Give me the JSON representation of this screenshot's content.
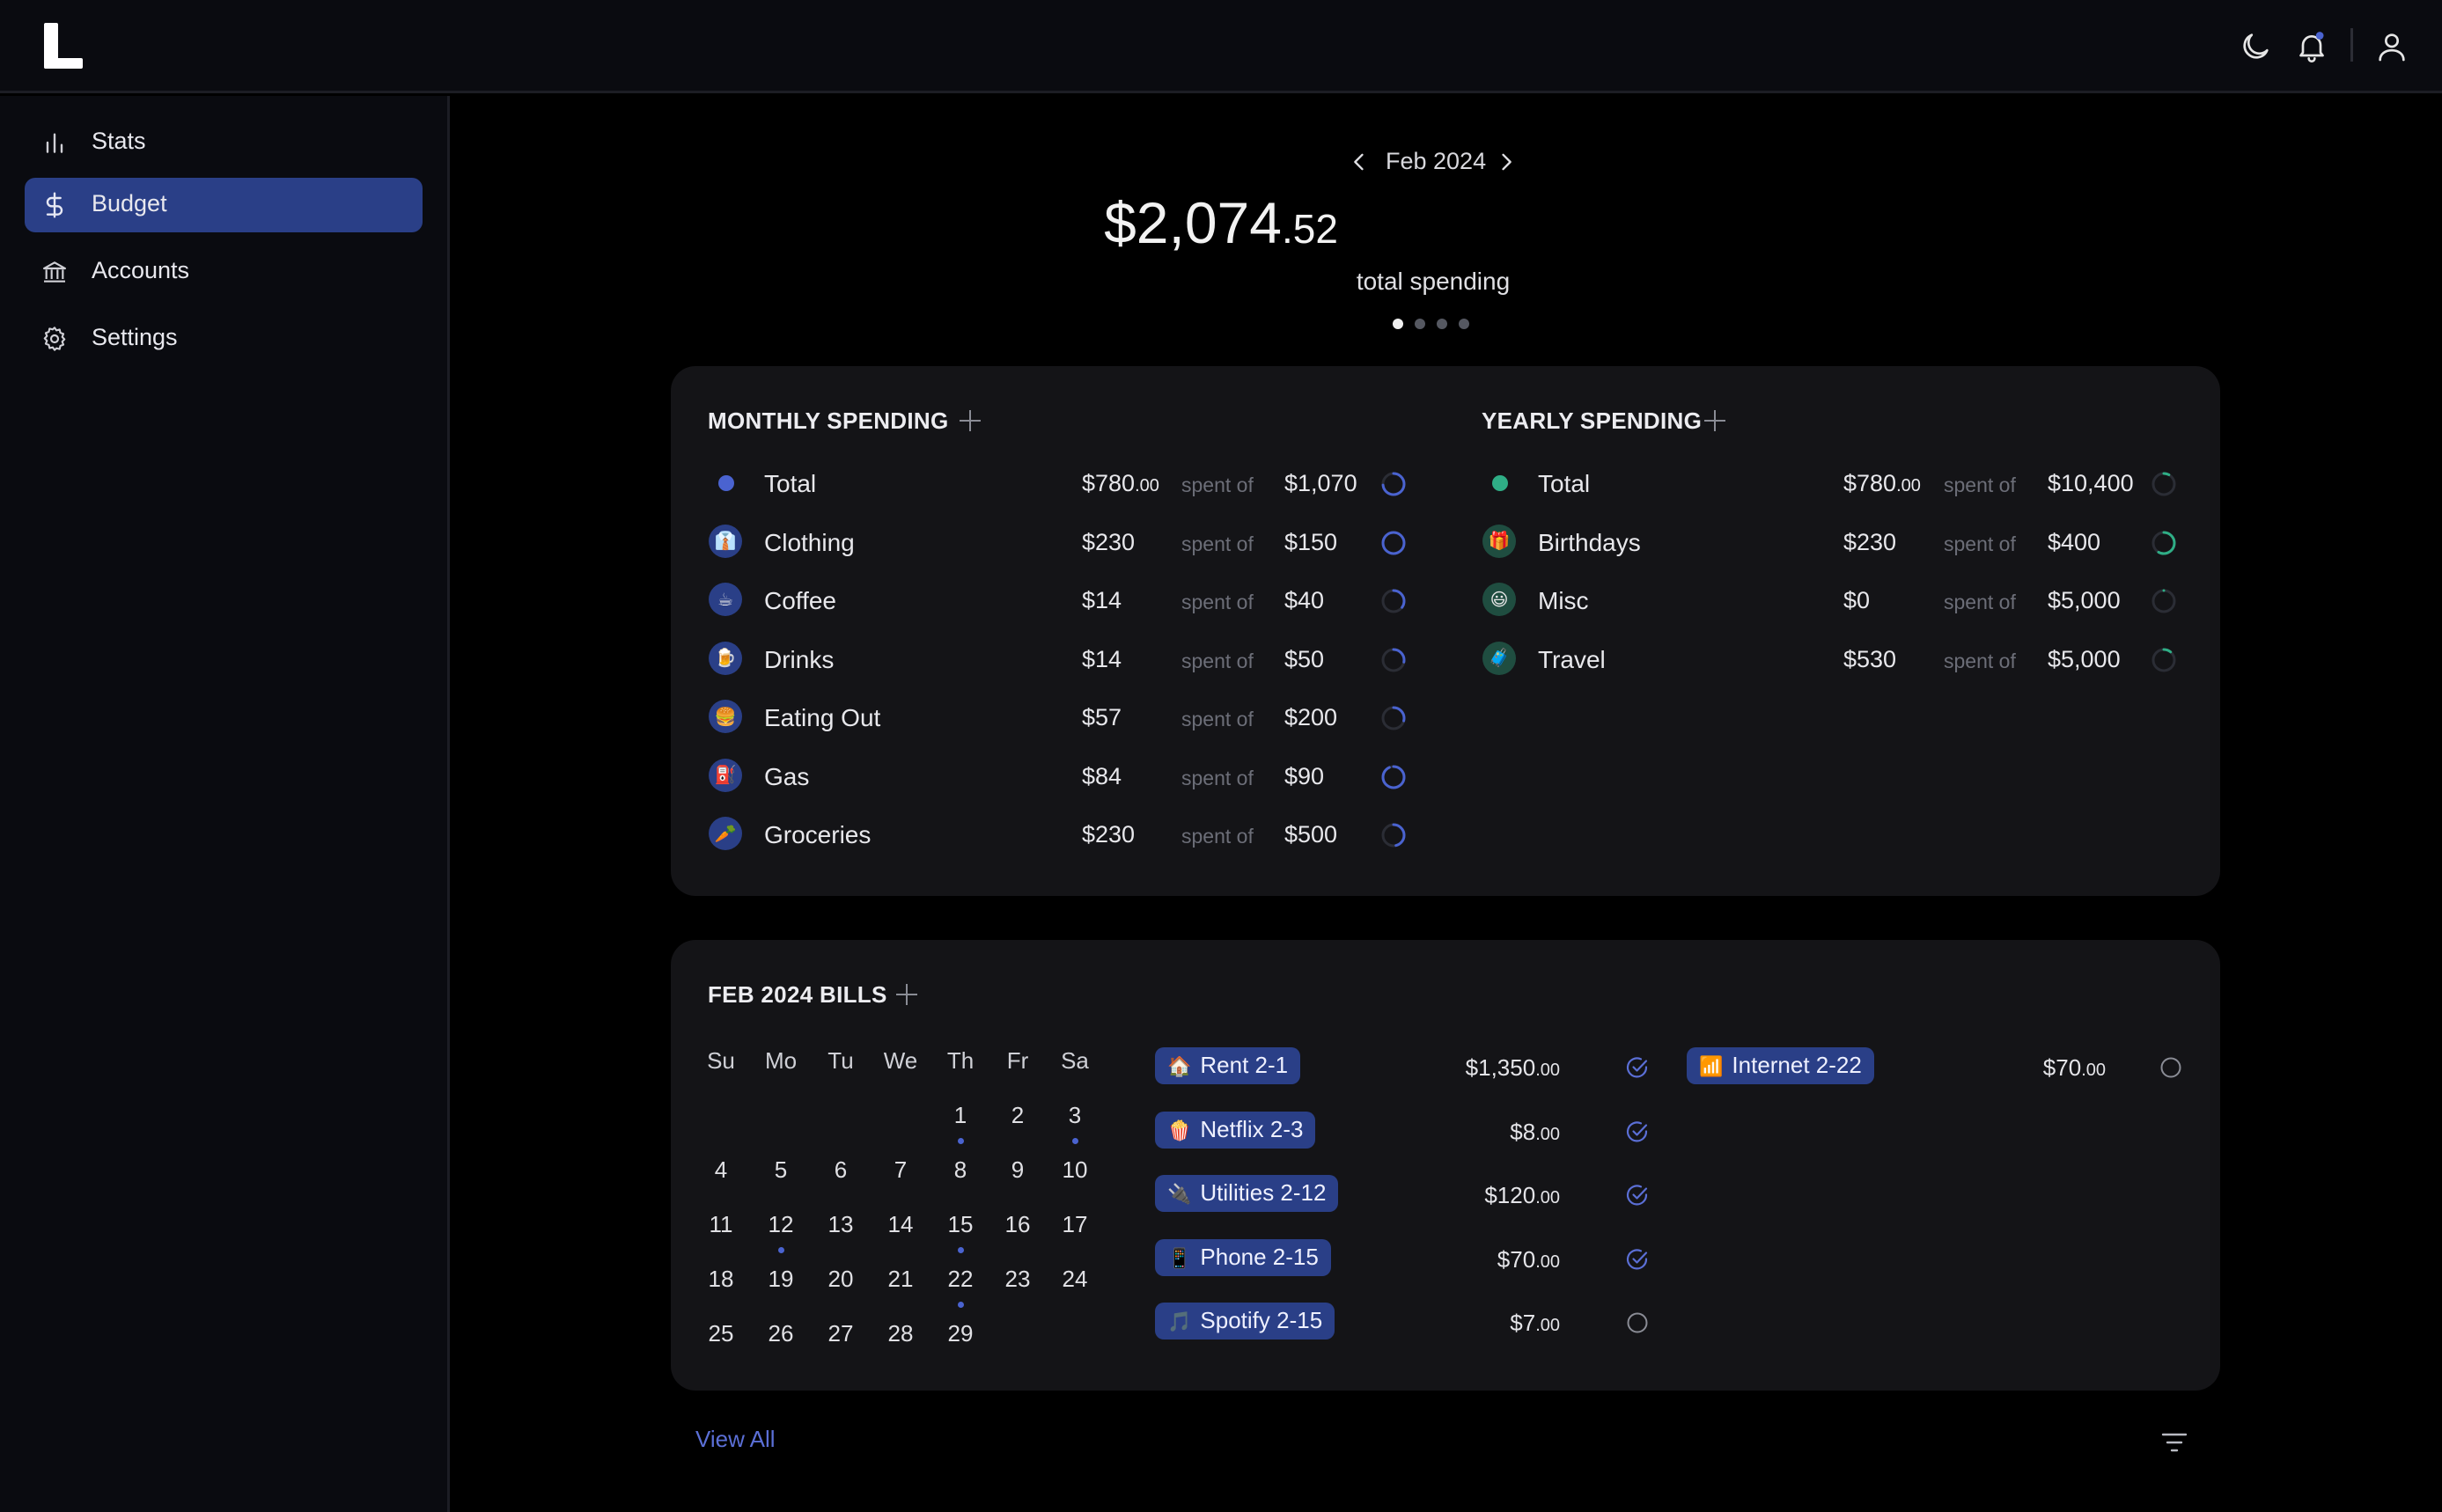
{
  "app": {
    "name": "L",
    "icons": [
      "moon-icon",
      "bell-icon",
      "user-icon"
    ],
    "notification_badge_color": "#4a63d0"
  },
  "sidebar": {
    "items": [
      {
        "label": "Stats",
        "icon": "bar-chart-icon",
        "active": false
      },
      {
        "label": "Budget",
        "icon": "dollar-icon",
        "active": true
      },
      {
        "label": "Accounts",
        "icon": "bank-icon",
        "active": false
      },
      {
        "label": "Settings",
        "icon": "gear-icon",
        "active": false
      }
    ]
  },
  "summary": {
    "month": "Feb 2024",
    "total_main": "$2,074",
    "total_cents": ".52",
    "total_label": "total spending",
    "page_index": 1,
    "page_count": 4
  },
  "monthly": {
    "title": "MONTHLY SPENDING",
    "of_label": "spent of",
    "rows": [
      {
        "name": "Total",
        "spent": "$780",
        "spent_cents": ".00",
        "budget": "$1,070",
        "icon": "dot",
        "progress": 0.73
      },
      {
        "name": "Clothing",
        "spent": "$230",
        "spent_cents": "",
        "budget": "$150",
        "icon": "👔",
        "progress": 1.0
      },
      {
        "name": "Coffee",
        "spent": "$14",
        "spent_cents": "",
        "budget": "$40",
        "icon": "☕",
        "progress": 0.35
      },
      {
        "name": "Drinks",
        "spent": "$14",
        "spent_cents": "",
        "budget": "$50",
        "icon": "🍺",
        "progress": 0.28
      },
      {
        "name": "Eating Out",
        "spent": "$57",
        "spent_cents": "",
        "budget": "$200",
        "icon": "🍔",
        "progress": 0.29
      },
      {
        "name": "Gas",
        "spent": "$84",
        "spent_cents": "",
        "budget": "$90",
        "icon": "⛽",
        "progress": 0.93
      },
      {
        "name": "Groceries",
        "spent": "$230",
        "spent_cents": "",
        "budget": "$500",
        "icon": "🥕",
        "progress": 0.46
      }
    ]
  },
  "yearly": {
    "title": "YEARLY SPENDING",
    "of_label": "spent of",
    "rows": [
      {
        "name": "Total",
        "spent": "$780",
        "spent_cents": ".00",
        "budget": "$10,400",
        "icon": "dot",
        "progress": 0.08
      },
      {
        "name": "Birthdays",
        "spent": "$230",
        "spent_cents": "",
        "budget": "$400",
        "icon": "🎁",
        "progress": 0.58
      },
      {
        "name": "Misc",
        "spent": "$0",
        "spent_cents": "",
        "budget": "$5,000",
        "icon": "😃",
        "progress": 0.0
      },
      {
        "name": "Travel",
        "spent": "$530",
        "spent_cents": "",
        "budget": "$5,000",
        "icon": "🧳",
        "progress": 0.11
      }
    ]
  },
  "bills": {
    "title": "FEB 2024 BILLS",
    "weekdays": [
      "Su",
      "Mo",
      "Tu",
      "We",
      "Th",
      "Fr",
      "Sa"
    ],
    "first_weekday_index": 4,
    "days_in_month": 29,
    "marked_days": [
      1,
      3,
      12,
      15,
      22
    ],
    "items": [
      {
        "label": "Rent 2-1",
        "emoji": "🏠",
        "amount": "$1,350",
        "cents": ".00",
        "paid": true
      },
      {
        "label": "Netflix 2-3",
        "emoji": "🍿",
        "amount": "$8",
        "cents": ".00",
        "paid": true
      },
      {
        "label": "Utilities 2-12",
        "emoji": "🔌",
        "amount": "$120",
        "cents": ".00",
        "paid": true
      },
      {
        "label": "Phone 2-15",
        "emoji": "📱",
        "amount": "$70",
        "cents": ".00",
        "paid": true
      },
      {
        "label": "Spotify 2-15",
        "emoji": "🎵",
        "amount": "$7",
        "cents": ".00",
        "paid": false
      },
      {
        "label": "Internet 2-22",
        "emoji": "📶",
        "amount": "$70",
        "cents": ".00",
        "paid": false
      }
    ]
  },
  "footer": {
    "view_all": "View All",
    "filter_icon": "filter-icon"
  },
  "colors": {
    "accent": "#2a3f87",
    "monthly_ring": "#4a63d0",
    "yearly_ring": "#2fae86",
    "link": "#5b6fd6"
  }
}
